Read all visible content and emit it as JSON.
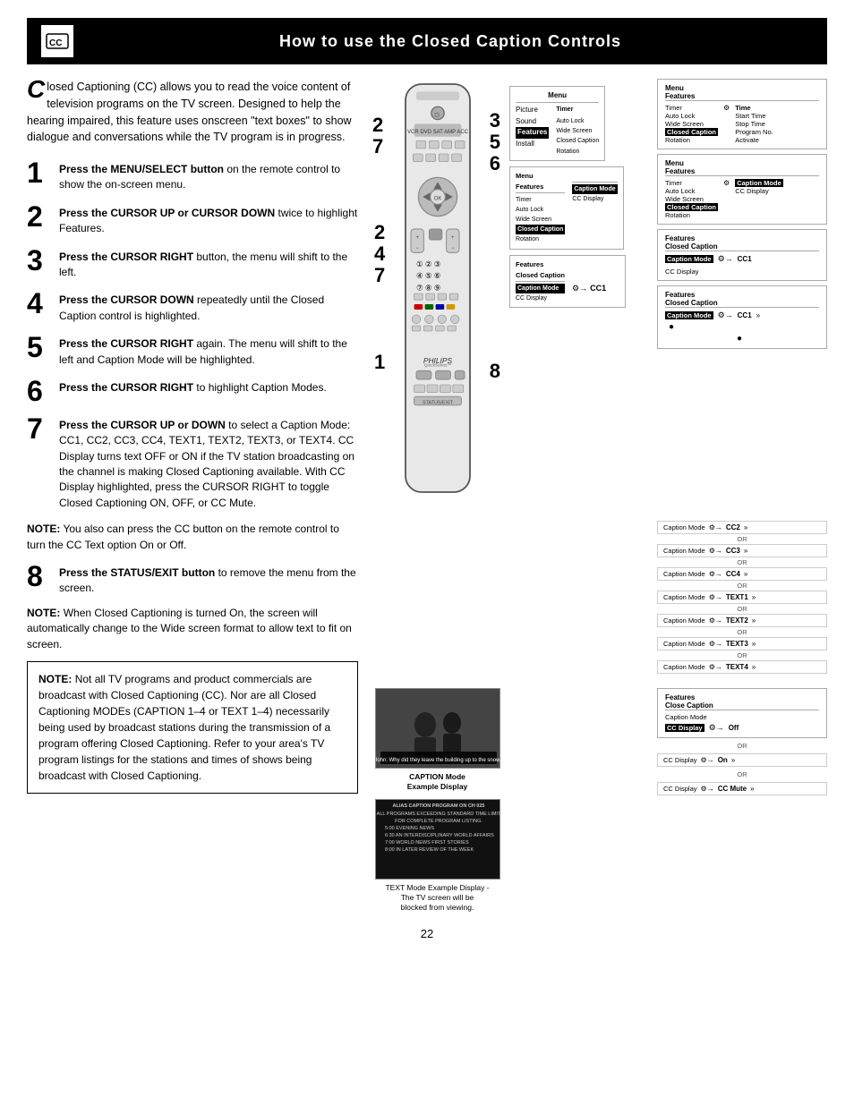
{
  "header": {
    "title": "How to use the Closed Caption Controls",
    "icon_label": "cc-icon"
  },
  "intro": {
    "drop_cap": "C",
    "text": "losed Captioning (CC) allows you to read the voice content of television programs on the TV screen.  Designed to help the hearing impaired, this feature uses onscreen \"text boxes\" to show dialogue and conversations while the TV program is in progress."
  },
  "steps": [
    {
      "number": "1",
      "text": "Press the MENU/SELECT button on the remote control to show the on-screen menu."
    },
    {
      "number": "2",
      "text": "Press the CURSOR UP or CURSOR DOWN twice to highlight Features."
    },
    {
      "number": "3",
      "text": "Press the CURSOR RIGHT button, the menu will shift to the left."
    },
    {
      "number": "4",
      "text": "Press the CURSOR DOWN repeatedly until the Closed Caption control is highlighted."
    },
    {
      "number": "5",
      "text": "Press the CURSOR RIGHT again. The menu will shift to the left and Caption Mode will be highlighted."
    },
    {
      "number": "6",
      "text": "Press the CURSOR RIGHT to highlight Caption Modes."
    },
    {
      "number": "7",
      "text": "Press the CURSOR UP or DOWN to select a Caption Mode:  CC1, CC2, CC3, CC4, TEXT1, TEXT2, TEXT3, or TEXT4. CC Display turns text OFF or ON if the TV station broadcasting on the channel is making Closed Captioning available. With CC Display highlighted, press the CURSOR RIGHT to toggle Closed Captioning ON, OFF, or CC Mute."
    }
  ],
  "note_inline_1": {
    "label": "NOTE:",
    "text": " You also can press the CC button on the remote control to turn the CC Text option On or Off."
  },
  "step_8": {
    "number": "8",
    "text": "Press the STATUS/EXIT button to remove the menu from the screen."
  },
  "note_inline_2": {
    "label": "NOTE:",
    "text": " When Closed Captioning is turned On, the screen will automatically change to the Wide screen format to allow text to fit on screen."
  },
  "note_box": {
    "label": "NOTE:",
    "text": "  Not all TV programs and product commercials are broadcast with Closed Captioning (CC).  Nor are all Closed Captioning  MODEs (CAPTION 1–4 or TEXT 1–4) necessarily being used by broadcast stations during the transmission of a program offering Closed Captioning.  Refer to your area's TV program listings for the stations and times of shows being broadcast with Closed Captioning."
  },
  "caption_mode_label": "CAPTION Mode\nExample Display",
  "text_mode_label": "TEXT Mode Example Display -\nThe TV screen will be\nblocked from viewing.",
  "page_number": "22",
  "menu_panels": [
    {
      "id": "panel1",
      "step_numbers": [
        "2",
        "7"
      ],
      "cols": [
        {
          "label": "Menu",
          "items": [
            "Picture",
            "Sound",
            "Features",
            "Install"
          ]
        },
        {
          "label": "",
          "items": [
            "Timer",
            "Auto Lock",
            "Wide Screen",
            "Closed Caption",
            "Rotation"
          ]
        }
      ]
    },
    {
      "id": "panel2",
      "step_numbers": [
        "3",
        "5",
        "6"
      ],
      "cols": [
        {
          "label": "Menu\nFeatures",
          "items": [
            "Timer",
            "Auto Lock",
            "Wide Screen",
            "Closed Caption",
            "Rotation"
          ]
        },
        {
          "label": "",
          "items": [
            "Caption Mode",
            "CC Display"
          ]
        }
      ]
    },
    {
      "id": "panel3",
      "step_numbers": [],
      "cols": [
        {
          "label": "Features\nClosed Caption",
          "items": []
        },
        {
          "label": "",
          "items": [
            "Caption Mode\nCC Display",
            "→ CC1"
          ]
        }
      ]
    }
  ],
  "arrow_boxes": [
    {
      "title": "Menu\nFeatures",
      "rows": [
        {
          "left": "Timer",
          "mid": "⚙",
          "right": "Time"
        },
        {
          "left": "Auto Lock",
          "mid": "",
          "right": "Start Time"
        },
        {
          "left": "Wide Screen",
          "mid": "",
          "right": "Stop Time"
        },
        {
          "left": "Closed Caption",
          "mid": "⚙",
          "right": "Program No."
        },
        {
          "left": "Rotation",
          "mid": "",
          "right": "Activate"
        }
      ]
    },
    {
      "title": "Menu\nFeatures",
      "rows": [
        {
          "left": "Timer",
          "mid": "",
          "right": ""
        },
        {
          "left": "Auto Lock",
          "mid": "",
          "right": "Caption Mode"
        },
        {
          "left": "Wide Screen",
          "mid": "",
          "right": "CC Display"
        },
        {
          "left": "Closed Caption",
          "mid": "⚙",
          "right": ""
        },
        {
          "left": "Rotation",
          "mid": "",
          "right": ""
        }
      ]
    },
    {
      "title": "Features\nClosed Caption",
      "rows": [
        {
          "left": "Caption Mode",
          "mid": "⚙→",
          "right": "CC1"
        }
      ]
    },
    {
      "title": "Features\nClosed Caption",
      "rows": [
        {
          "left": "Caption Mode",
          "mid": "⚙→",
          "right": "CC1"
        },
        {
          "left": "",
          "mid": "",
          "right": ""
        },
        {
          "left": "",
          "mid": "",
          "right": "●"
        }
      ]
    }
  ],
  "cc_mode_rows": [
    {
      "label": "Caption Mode",
      "arrow": "⚙→",
      "value": "CC2",
      "suffix": "»"
    },
    {
      "label": "OR"
    },
    {
      "label": "Caption Mode",
      "arrow": "⚙→",
      "value": "CC3",
      "suffix": "»"
    },
    {
      "label": "OR"
    },
    {
      "label": "Caption Mode",
      "arrow": "⚙→",
      "value": "CC4",
      "suffix": "»"
    },
    {
      "label": "OR"
    },
    {
      "label": "Caption Mode",
      "arrow": "⚙→",
      "value": "TEXT1",
      "suffix": "»"
    },
    {
      "label": "OR"
    },
    {
      "label": "Caption Mode",
      "arrow": "⚙→",
      "value": "TEXT2",
      "suffix": "»"
    },
    {
      "label": "OR"
    },
    {
      "label": "Caption Mode",
      "arrow": "⚙→",
      "value": "TEXT3",
      "suffix": "»"
    },
    {
      "label": "OR"
    },
    {
      "label": "Caption Mode",
      "arrow": "⚙→",
      "value": "TEXT4",
      "suffix": "»"
    }
  ],
  "cc_display_box": {
    "title": "Features\nClose Caption",
    "row": {
      "label": "Caption Mode\nCC Display",
      "arrow": "⚙→",
      "value": "Off"
    }
  },
  "cc_display_rows": [
    {
      "label": "CC Display",
      "arrow": "⚙→",
      "value": "On",
      "suffix": "»"
    },
    {
      "label": "OR"
    },
    {
      "label": "CC Display",
      "arrow": "⚙→",
      "value": "CC Mute",
      "suffix": "»"
    }
  ]
}
